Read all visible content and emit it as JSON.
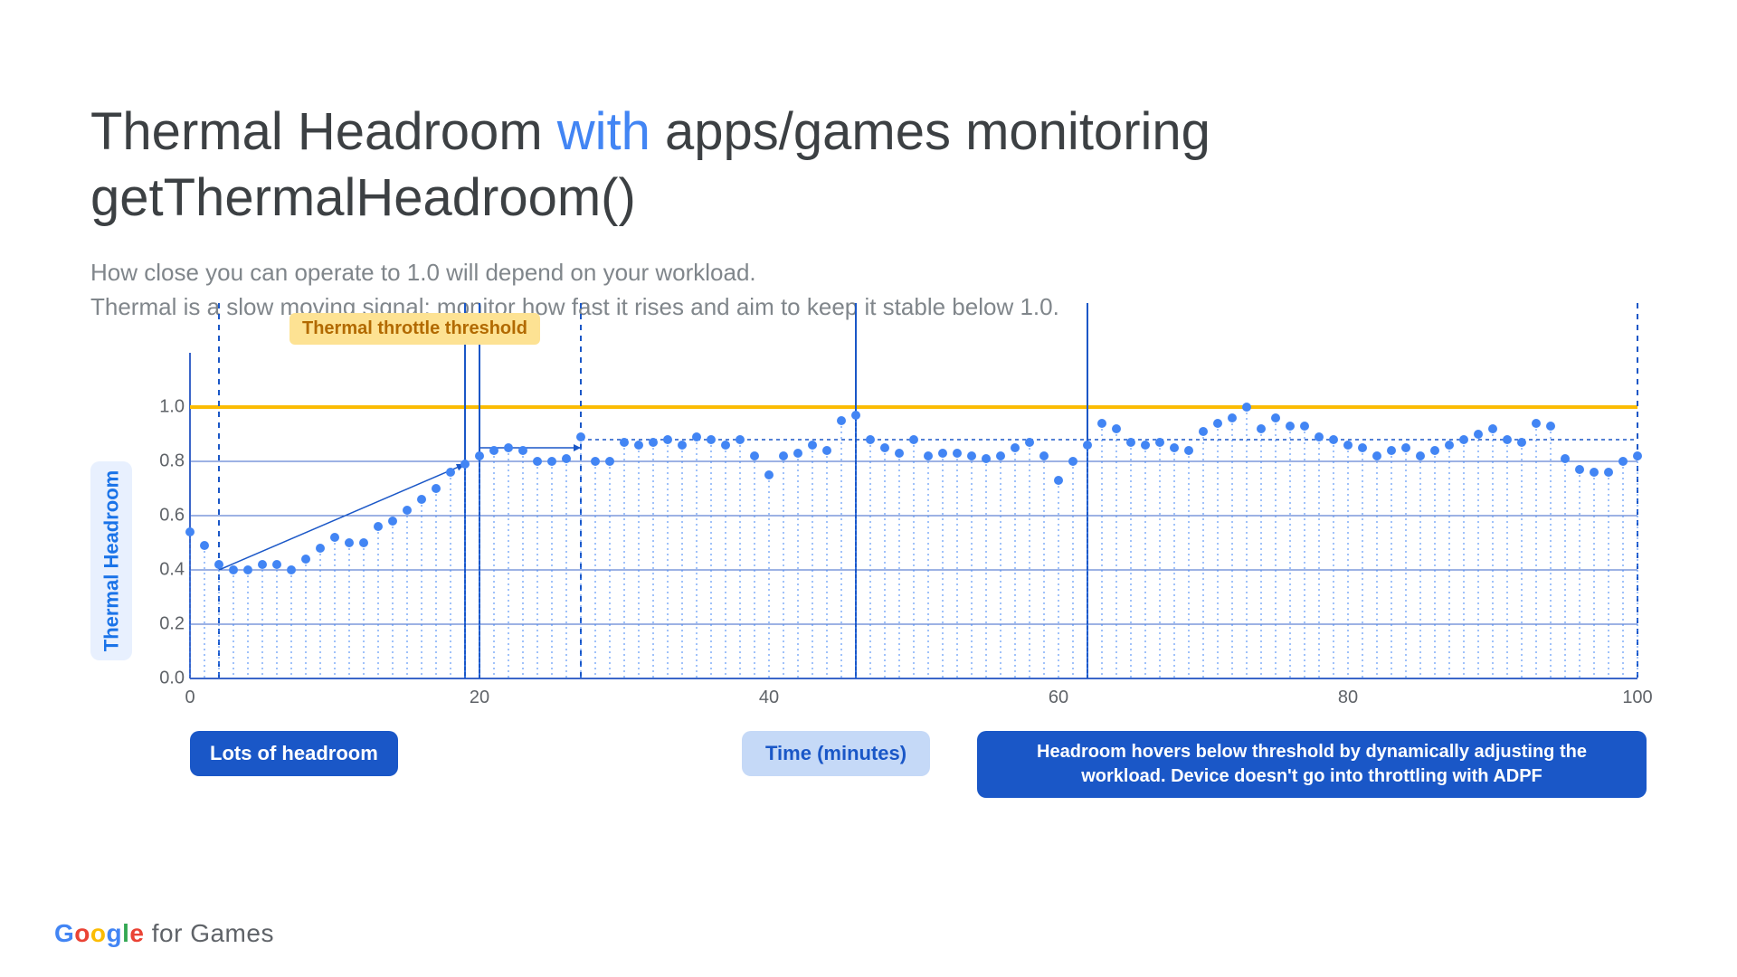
{
  "title": {
    "pre": "Thermal Headroom ",
    "accent": "with",
    "post": " apps/games monitoring getThermalHeadroom()"
  },
  "subtitle_l1": "How close you can operate to 1.0 will depend on your workload.",
  "subtitle_l2": "Thermal is a slow moving signal; monitor how fast it rises and aim to keep it stable below 1.0.",
  "ylabel": "Thermal Headroom",
  "xlabel": "Time (minutes)",
  "threshold_label": "Thermal throttle threshold",
  "callout_a": "Lots of headroom",
  "callout_c": "Headroom hovers below threshold by dynamically adjusting the workload. Device doesn't go into throttling with ADPF",
  "logo": {
    "word": "Google",
    "rest": " for Games"
  },
  "chart_data": {
    "type": "scatter",
    "xlabel": "Time (minutes)",
    "ylabel": "Thermal Headroom",
    "xlim": [
      0,
      100
    ],
    "ylim": [
      0.0,
      1.2
    ],
    "ygrid": [
      0.0,
      0.2,
      0.4,
      0.6,
      0.8,
      1.0
    ],
    "xticks": [
      0,
      20,
      40,
      60,
      80,
      100
    ],
    "threshold": 1.0,
    "region_dividers_x": [
      2,
      19,
      20,
      27,
      46,
      62,
      100
    ],
    "region_dividers_style": [
      "dashed",
      "solid",
      "solid",
      "dashed",
      "solid",
      "solid",
      "dashed"
    ],
    "trend_arrow": {
      "from": [
        2,
        0.4
      ],
      "to": [
        19,
        0.79
      ]
    },
    "hline_y": 0.88,
    "hline_x_from": 27,
    "series": [
      {
        "name": "Thermal Headroom",
        "color": "#1a73e8",
        "x": [
          0,
          1,
          2,
          3,
          4,
          5,
          6,
          7,
          8,
          9,
          10,
          11,
          12,
          13,
          14,
          15,
          16,
          17,
          18,
          19,
          20,
          21,
          22,
          23,
          24,
          25,
          26,
          27,
          28,
          29,
          30,
          31,
          32,
          33,
          34,
          35,
          36,
          37,
          38,
          39,
          40,
          41,
          42,
          43,
          44,
          45,
          46,
          47,
          48,
          49,
          50,
          51,
          52,
          53,
          54,
          55,
          56,
          57,
          58,
          59,
          60,
          61,
          62,
          63,
          64,
          65,
          66,
          67,
          68,
          69,
          70,
          71,
          72,
          73,
          74,
          75,
          76,
          77,
          78,
          79,
          80,
          81,
          82,
          83,
          84,
          85,
          86,
          87,
          88,
          89,
          90,
          91,
          92,
          93,
          94,
          95,
          96,
          97,
          98,
          99,
          100
        ],
        "values": [
          0.54,
          0.49,
          0.42,
          0.4,
          0.4,
          0.42,
          0.42,
          0.4,
          0.44,
          0.48,
          0.52,
          0.5,
          0.5,
          0.56,
          0.58,
          0.62,
          0.66,
          0.7,
          0.76,
          0.79,
          0.82,
          0.84,
          0.85,
          0.84,
          0.8,
          0.8,
          0.81,
          0.89,
          0.8,
          0.8,
          0.87,
          0.86,
          0.87,
          0.88,
          0.86,
          0.89,
          0.88,
          0.86,
          0.88,
          0.82,
          0.75,
          0.82,
          0.83,
          0.86,
          0.84,
          0.95,
          0.97,
          0.88,
          0.85,
          0.83,
          0.88,
          0.82,
          0.83,
          0.83,
          0.82,
          0.81,
          0.82,
          0.85,
          0.87,
          0.82,
          0.73,
          0.8,
          0.86,
          0.94,
          0.92,
          0.87,
          0.86,
          0.87,
          0.85,
          0.84,
          0.91,
          0.94,
          0.96,
          1.0,
          0.92,
          0.96,
          0.93,
          0.93,
          0.89,
          0.88,
          0.86,
          0.85,
          0.82,
          0.84,
          0.85,
          0.82,
          0.84,
          0.86,
          0.88,
          0.9,
          0.92,
          0.88,
          0.87,
          0.94,
          0.93,
          0.81,
          0.77,
          0.76,
          0.76,
          0.8,
          0.82
        ]
      }
    ]
  }
}
